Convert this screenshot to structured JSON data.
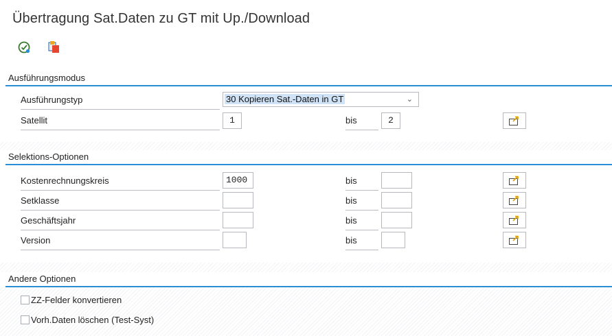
{
  "window": {
    "title": "Übertragung Sat.Daten zu GT mit Up./Download"
  },
  "toolbar": {
    "icons": [
      "execute-icon",
      "variants-icon"
    ]
  },
  "sections": {
    "execution": {
      "header": "Ausführungsmodus",
      "type_label": "Ausführungstyp",
      "type_value": "30 Kopieren Sat.-Daten in GT",
      "satellite_label": "Satellit",
      "satellite_from": "1",
      "bis": "bis",
      "satellite_to": "2"
    },
    "selection": {
      "header": "Selektions-Optionen",
      "bis": "bis",
      "rows": [
        {
          "label": "Kostenrechnungskreis",
          "from": "1000",
          "to": ""
        },
        {
          "label": "Setklasse",
          "from": "",
          "to": ""
        },
        {
          "label": "Geschäftsjahr",
          "from": "",
          "to": ""
        },
        {
          "label": "Version",
          "from": "",
          "to": ""
        }
      ]
    },
    "other": {
      "header": "Andere Optionen",
      "options": [
        {
          "label": "ZZ-Felder konvertieren",
          "checked": false
        },
        {
          "label": "Vorh.Daten löschen (Test-Syst)",
          "checked": false
        }
      ]
    }
  }
}
